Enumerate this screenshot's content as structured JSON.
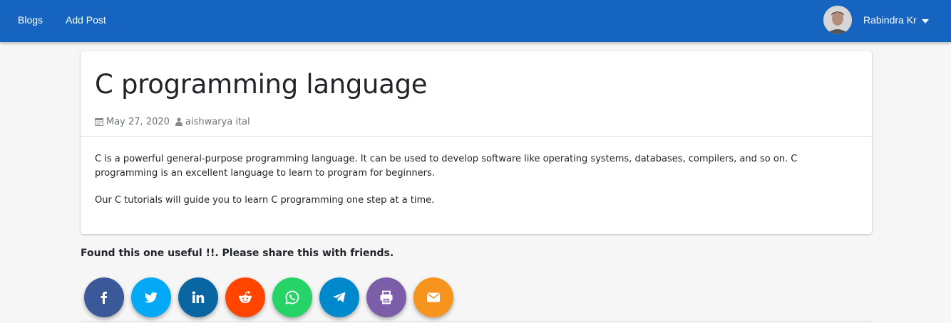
{
  "navbar": {
    "links": [
      "Blogs",
      "Add Post"
    ],
    "user_name": "Rabindra Kr",
    "background": "#1565c0"
  },
  "post": {
    "title": "C programming language",
    "date": "May 27, 2020",
    "author": "aishwarya ital",
    "paragraphs": [
      "C is a powerful general-purpose programming language. It can be used to develop software like operating systems, databases, compilers, and so on. C programming is an excellent language to learn to program for beginners.",
      "Our C tutorials will guide you to learn C programming one step at a time."
    ]
  },
  "share": {
    "heading": "Found this one useful !!. Please share this with friends.",
    "buttons": [
      {
        "network": "facebook",
        "icon": "facebook-icon",
        "color": "#3b5998"
      },
      {
        "network": "twitter",
        "icon": "twitter-icon",
        "color": "#03a9f4"
      },
      {
        "network": "linkedin",
        "icon": "linkedin-icon",
        "color": "#0a66a0"
      },
      {
        "network": "reddit",
        "icon": "reddit-icon",
        "color": "#ff4500"
      },
      {
        "network": "whatsapp",
        "icon": "whatsapp-icon",
        "color": "#25d366"
      },
      {
        "network": "telegram",
        "icon": "telegram-icon",
        "color": "#0088cc"
      },
      {
        "network": "print",
        "icon": "print-icon",
        "color": "#7b5ea7"
      },
      {
        "network": "email",
        "icon": "email-icon",
        "color": "#f7941d"
      }
    ]
  }
}
